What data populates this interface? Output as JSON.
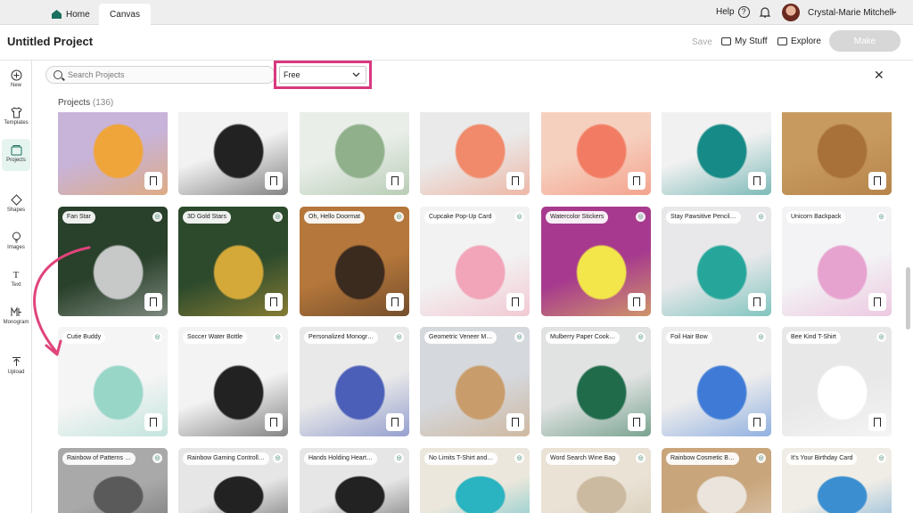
{
  "tabs": {
    "home": "Home",
    "canvas": "Canvas"
  },
  "topbar": {
    "help": "Help",
    "user_name": "Crystal-Marie Mitchell"
  },
  "header": {
    "title": "Untitled Project",
    "save": "Save",
    "my_stuff": "My Stuff",
    "explore": "Explore",
    "make": "Make"
  },
  "rail": [
    {
      "label": "New",
      "icon": "plus-circle-icon"
    },
    {
      "label": "Templates",
      "icon": "shirt-icon"
    },
    {
      "label": "Projects",
      "icon": "projects-icon"
    },
    {
      "label": "Shapes",
      "icon": "shapes-icon"
    },
    {
      "label": "Images",
      "icon": "lightbulb-icon"
    },
    {
      "label": "Text",
      "icon": "text-icon"
    },
    {
      "label": "Monogram",
      "icon": "monogram-icon"
    },
    {
      "label": "Upload",
      "icon": "upload-icon"
    }
  ],
  "search": {
    "placeholder": "Search Projects"
  },
  "filter": {
    "selected": "Free"
  },
  "projects": {
    "heading": "Projects",
    "count": "(136)"
  },
  "colors": {
    "accent": "#1b6f5f",
    "highlight": "#d9387e",
    "make_disabled": "#d7d7d7"
  },
  "rows": [
    [
      {
        "label": "",
        "colors": [
          "#c8b3d9",
          "#f0a53a"
        ]
      },
      {
        "label": "",
        "colors": [
          "#f2f2f2",
          "#222222"
        ]
      },
      {
        "label": "",
        "colors": [
          "#e9eee9",
          "#8fb08a"
        ]
      },
      {
        "label": "",
        "colors": [
          "#eaeaea",
          "#f08a6a"
        ]
      },
      {
        "label": "",
        "colors": [
          "#f6d0bf",
          "#f27c63"
        ]
      },
      {
        "label": "",
        "colors": [
          "#f1f1f1",
          "#168a86"
        ]
      },
      {
        "label": "",
        "colors": [
          "#c79a5f",
          "#a8713a"
        ]
      }
    ],
    [
      {
        "label": "Fan Star",
        "colors": [
          "#29402a",
          "#c7c9c9"
        ]
      },
      {
        "label": "3D Gold Stars",
        "colors": [
          "#2d4a2c",
          "#d4a93a"
        ]
      },
      {
        "label": "Oh, Hello Doormat",
        "colors": [
          "#b5773b",
          "#3b2a1e"
        ]
      },
      {
        "label": "Cupcake Pop-Up Card",
        "colors": [
          "#f2f2f2",
          "#f2a4b8"
        ]
      },
      {
        "label": "Watercolor Stickers",
        "colors": [
          "#a73a8e",
          "#f2e64a"
        ]
      },
      {
        "label": "Stay Pawsitive Pencil…",
        "colors": [
          "#e8e8ea",
          "#26a69a"
        ]
      },
      {
        "label": "Unicorn Backpack",
        "colors": [
          "#f3f3f5",
          "#e7a3cf"
        ]
      }
    ],
    [
      {
        "label": "Cutie Buddy",
        "colors": [
          "#f5f5f5",
          "#98d6c8"
        ]
      },
      {
        "label": "Soccer Water Bottle",
        "colors": [
          "#f3f3f3",
          "#222222"
        ]
      },
      {
        "label": "Personalized Monogr…",
        "colors": [
          "#e9e9e9",
          "#4b5fb8"
        ]
      },
      {
        "label": "Geometric Veneer M…",
        "colors": [
          "#d5d8dd",
          "#c99d6b"
        ]
      },
      {
        "label": "Mulberry Paper Cook…",
        "colors": [
          "#e1e3e2",
          "#1f6b4a"
        ]
      },
      {
        "label": "Foil Hair Bow",
        "colors": [
          "#ededed",
          "#3f7bd6"
        ]
      },
      {
        "label": "Bee Kind T-Shirt",
        "colors": [
          "#e8e8e8",
          "#ffffff"
        ]
      }
    ],
    [
      {
        "label": "Rainbow of Patterns …",
        "colors": [
          "#a9a9a9",
          "#5a5a5a"
        ]
      },
      {
        "label": "Rainbow Gaming Controll…",
        "colors": [
          "#e6e6e6",
          "#222222"
        ]
      },
      {
        "label": "Hands Holding Heart…",
        "colors": [
          "#e6e6e6",
          "#222222"
        ]
      },
      {
        "label": "No Limits T-Shirt and…",
        "colors": [
          "#ece7dc",
          "#2ab3c0"
        ]
      },
      {
        "label": "Word Search Wine Bag",
        "colors": [
          "#e9e2d5",
          "#cbb9a0"
        ]
      },
      {
        "label": "Rainbow Cosmetic B…",
        "colors": [
          "#c9a57b",
          "#eae4dc"
        ]
      },
      {
        "label": "It's Your Birthday Card",
        "colors": [
          "#f0ede6",
          "#3b8fd0"
        ]
      }
    ]
  ]
}
